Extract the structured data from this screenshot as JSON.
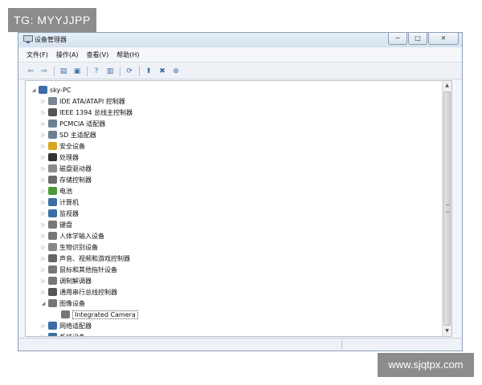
{
  "watermark_top": "TG: MYYJJPP",
  "watermark_bottom": "www.sjqtpx.com",
  "window": {
    "title": "设备管理器",
    "controls": [
      "─",
      "□",
      "✕"
    ]
  },
  "menu": [
    "文件(F)",
    "操作(A)",
    "查看(V)",
    "帮助(H)"
  ],
  "toolbar": [
    {
      "icon": "back-icon",
      "glyph": "⇦"
    },
    {
      "icon": "forward-icon",
      "glyph": "⇨"
    },
    {
      "sep": true
    },
    {
      "icon": "properties-icon",
      "glyph": "▤"
    },
    {
      "icon": "view-icon",
      "glyph": "▣"
    },
    {
      "sep": true
    },
    {
      "icon": "help-icon",
      "glyph": "?"
    },
    {
      "icon": "details-icon",
      "glyph": "▥"
    },
    {
      "sep": true
    },
    {
      "icon": "scan-hardware-icon",
      "glyph": "⟳"
    },
    {
      "sep": true
    },
    {
      "icon": "update-driver-icon",
      "glyph": "⬆"
    },
    {
      "icon": "disable-device-icon",
      "glyph": "✖"
    },
    {
      "icon": "uninstall-device-icon",
      "glyph": "⊗"
    }
  ],
  "tree": {
    "root": "sky-PC",
    "items": [
      {
        "label": "IDE ATA/ATAPI 控制器",
        "expander": "▷",
        "icon": "ide-controller-icon",
        "color": "#7a8796"
      },
      {
        "label": "IEEE 1394 总线主控制器",
        "expander": "▷",
        "icon": "ieee1394-icon",
        "color": "#555555"
      },
      {
        "label": "PCMCIA 适配器",
        "expander": "▷",
        "icon": "pcmcia-icon",
        "color": "#6d7f94"
      },
      {
        "label": "SD 主适配器",
        "expander": "▷",
        "icon": "sd-host-icon",
        "color": "#6d7f94"
      },
      {
        "label": "安全设备",
        "expander": "▷",
        "icon": "security-device-icon",
        "color": "#d9a520"
      },
      {
        "label": "处理器",
        "expander": "▷",
        "icon": "processor-icon",
        "color": "#333333"
      },
      {
        "label": "磁盘驱动器",
        "expander": "▷",
        "icon": "disk-drive-icon",
        "color": "#8c8c8c"
      },
      {
        "label": "存储控制器",
        "expander": "▷",
        "icon": "storage-controller-icon",
        "color": "#6a6a6a"
      },
      {
        "label": "电池",
        "expander": "▷",
        "icon": "battery-icon",
        "color": "#4a9a3a"
      },
      {
        "label": "计算机",
        "expander": "▷",
        "icon": "computer-icon",
        "color": "#3a6ea5"
      },
      {
        "label": "监视器",
        "expander": "▷",
        "icon": "monitor-icon",
        "color": "#3a6ea5"
      },
      {
        "label": "键盘",
        "expander": "▷",
        "icon": "keyboard-icon",
        "color": "#777777"
      },
      {
        "label": "人体学输入设备",
        "expander": "▷",
        "icon": "hid-icon",
        "color": "#777777"
      },
      {
        "label": "生物识别设备",
        "expander": "▷",
        "icon": "biometric-icon",
        "color": "#888888"
      },
      {
        "label": "声音、视频和游戏控制器",
        "expander": "▷",
        "icon": "sound-icon",
        "color": "#666666"
      },
      {
        "label": "鼠标和其他指针设备",
        "expander": "▷",
        "icon": "mouse-icon",
        "color": "#777777"
      },
      {
        "label": "调制解调器",
        "expander": "▷",
        "icon": "modem-icon",
        "color": "#777777"
      },
      {
        "label": "通用串行总线控制器",
        "expander": "▷",
        "icon": "usb-controller-icon",
        "color": "#555555"
      },
      {
        "label": "图像设备",
        "expander": "◢",
        "icon": "imaging-device-icon",
        "color": "#777777"
      },
      {
        "label": "Integrated Camera",
        "expander": "",
        "icon": "camera-icon",
        "color": "#777777",
        "child": true,
        "selected": true
      },
      {
        "label": "网络适配器",
        "expander": "▷",
        "icon": "network-adapter-icon",
        "color": "#3a6ea5"
      },
      {
        "label": "系统设备",
        "expander": "▷",
        "icon": "system-devices-icon",
        "color": "#3a6ea5"
      }
    ]
  }
}
